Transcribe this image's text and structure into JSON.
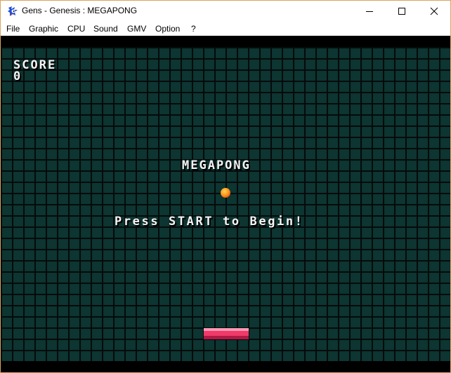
{
  "window": {
    "title": "Gens - Genesis : MEGAPONG",
    "app_icon": "sonic-icon",
    "controls": [
      "minimize-icon",
      "maximize-icon",
      "close-icon"
    ]
  },
  "menu": {
    "items": [
      "File",
      "Graphic",
      "CPU",
      "Sound",
      "GMV",
      "Option",
      "?"
    ]
  },
  "game": {
    "score_label": "SCORE",
    "score_value": "0",
    "title": "MEGAPONG",
    "prompt": "Press START to Begin!",
    "colors": {
      "background": "#0d3531",
      "grid_lines": "#050b0b",
      "text": "#f4f4f4",
      "ball": "#ff9a1a",
      "paddle": "#f03a6a"
    }
  }
}
